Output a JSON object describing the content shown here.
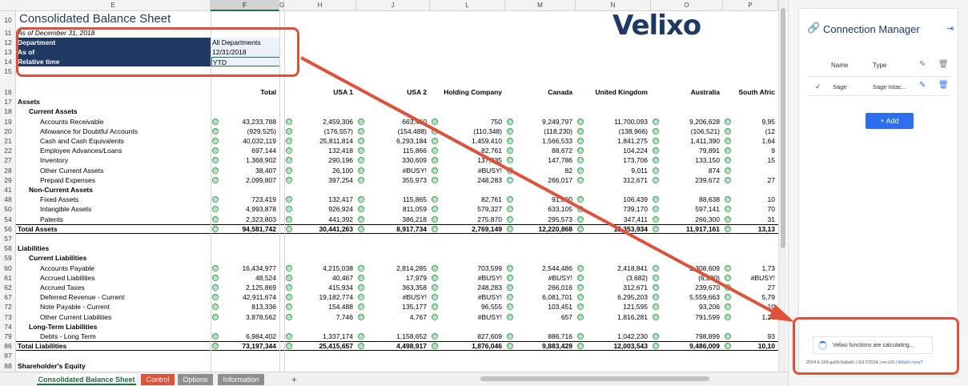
{
  "sheet": {
    "columns": [
      "E",
      "F",
      "G",
      "H",
      "J",
      "L",
      "M",
      "N",
      "O",
      "P"
    ],
    "selected_column": "F",
    "title": "Consolidated Balance Sheet",
    "subtitle": "As of December 31, 2018",
    "logo": "Velixo",
    "params": [
      {
        "label": "Department",
        "value": "All Departments"
      },
      {
        "label": "As of",
        "value": "12/31/2018"
      },
      {
        "label": "Relative time",
        "value": "YTD"
      }
    ],
    "top_rows": [
      "10",
      "11",
      "12",
      "13",
      "14",
      "15"
    ],
    "col_headers": [
      "Total",
      "USA 1",
      "USA 2",
      "Holding Company",
      "Canada",
      "United Kingdom",
      "Australia",
      "South Afric"
    ],
    "rows": [
      {
        "r": "16",
        "label": "",
        "kind": "hdr",
        "vals": []
      },
      {
        "r": "17",
        "label": "Assets",
        "kind": "bold",
        "vals": []
      },
      {
        "r": "18",
        "label": "Current Assets",
        "kind": "sub",
        "vals": []
      },
      {
        "r": "19",
        "label": "Accounts Receivable",
        "kind": "item",
        "vals": [
          "43,233,788",
          "2,459,306",
          "663,410",
          "750",
          "9,249,797",
          "11,700,093",
          "9,206,628",
          "9,95"
        ]
      },
      {
        "r": "20",
        "label": "Allowance for Doubtful Accounts",
        "kind": "item",
        "vals": [
          "(929,525)",
          "(176,557)",
          "(154,488)",
          "(110,348)",
          "(118,230)",
          "(138,966)",
          "(106,521)",
          "(12"
        ]
      },
      {
        "r": "21",
        "label": "Cash and Cash Equivalents",
        "kind": "item",
        "vals": [
          "40,032,119",
          "25,811,814",
          "6,293,184",
          "1,459,410",
          "1,566,533",
          "1,841,275",
          "1,411,390",
          "1,64"
        ]
      },
      {
        "r": "22",
        "label": "Employee Advances/Loans",
        "kind": "item",
        "vals": [
          "697,144",
          "132,418",
          "115,866",
          "82,761",
          "88,672",
          "104,224",
          "79,891",
          "9"
        ]
      },
      {
        "r": "27",
        "label": "Inventory",
        "kind": "item",
        "vals": [
          "1,368,902",
          "290,196",
          "330,609",
          "137,935",
          "147,786",
          "173,706",
          "133,150",
          "15"
        ]
      },
      {
        "r": "28",
        "label": "Other Current Assets",
        "kind": "item",
        "vals": [
          "38,407",
          "26,100",
          "#BUSY!",
          "#BUSY!",
          "82",
          "9,011",
          "874",
          ""
        ]
      },
      {
        "r": "29",
        "label": "Prepaid Expenses",
        "kind": "item",
        "vals": [
          "2,099,807",
          "397,254",
          "355,973",
          "248,283",
          "266,017",
          "312,671",
          "239,672",
          "27"
        ]
      },
      {
        "r": "41",
        "label": "Non-Current Assets",
        "kind": "sub",
        "vals": []
      },
      {
        "r": "48",
        "label": "Fixed Assets",
        "kind": "item",
        "vals": [
          "723,419",
          "132,417",
          "115,865",
          "82,761",
          "91,000",
          "106,439",
          "88,638",
          "10"
        ]
      },
      {
        "r": "50",
        "label": "Intangible Assets",
        "kind": "item",
        "vals": [
          "4,993,878",
          "926,924",
          "811,059",
          "579,327",
          "633,105",
          "739,170",
          "597,141",
          "70"
        ]
      },
      {
        "r": "54",
        "label": "Patents",
        "kind": "item",
        "vals": [
          "2,323,803",
          "441,392",
          "386,218",
          "275,870",
          "295,573",
          "347,411",
          "266,300",
          "31"
        ]
      },
      {
        "r": "56",
        "label": "Total Assets",
        "kind": "total",
        "vals": [
          "94,581,742",
          "30,441,263",
          "8,917,734",
          "2,769,149",
          "12,220,868",
          "15,353,934",
          "11,917,161",
          "13,13"
        ]
      },
      {
        "r": "57",
        "label": "",
        "kind": "blank",
        "vals": []
      },
      {
        "r": "58",
        "label": "Liabilities",
        "kind": "bold",
        "vals": []
      },
      {
        "r": "59",
        "label": "Current Liabilities",
        "kind": "sub",
        "vals": []
      },
      {
        "r": "60",
        "label": "Accounts Payable",
        "kind": "item",
        "vals": [
          "16,434,977",
          "4,215,038",
          "2,814,285",
          "703,599",
          "2,544,486",
          "2,418,841",
          "2,308,609",
          "1,73"
        ]
      },
      {
        "r": "61",
        "label": "Accrued Liabilities",
        "kind": "item",
        "vals": [
          "48,524",
          "40,467",
          "17,979",
          "#BUSY!",
          "#BUSY!",
          "(3,682)",
          "(6,290)",
          "#BUSY!"
        ]
      },
      {
        "r": "62",
        "label": "Accrued Taxes",
        "kind": "item",
        "vals": [
          "2,125,869",
          "415,934",
          "363,358",
          "248,283",
          "266,016",
          "312,671",
          "239,670",
          "27"
        ]
      },
      {
        "r": "67",
        "label": "Deferred Revenue - Current",
        "kind": "item",
        "vals": [
          "42,911,674",
          "19,182,774",
          "#BUSY!",
          "#BUSY!",
          "6,081,701",
          "6,295,203",
          "5,559,663",
          "5,79"
        ]
      },
      {
        "r": "72",
        "label": "Note Payable - Current",
        "kind": "item",
        "vals": [
          "813,336",
          "154,488",
          "135,177",
          "96,555",
          "103,451",
          "121,595",
          "93,206",
          "10"
        ]
      },
      {
        "r": "73",
        "label": "Other Current Liabilities",
        "kind": "item",
        "vals": [
          "3,878,562",
          "7,746",
          "4,767",
          "#BUSY!",
          "657",
          "1,816,281",
          "791,599",
          "1,25"
        ]
      },
      {
        "r": "74",
        "label": "Long-Term Liabilities",
        "kind": "sub",
        "vals": []
      },
      {
        "r": "79",
        "label": "Debts - Long Term",
        "kind": "item",
        "vals": [
          "6,984,402",
          "1,337,174",
          "1,158,652",
          "827,609",
          "886,716",
          "1,042,230",
          "798,899",
          "93"
        ]
      },
      {
        "r": "86",
        "label": "Total Liabilities",
        "kind": "total",
        "vals": [
          "73,197,344",
          "25,415,657",
          "4,498,917",
          "1,876,046",
          "9,883,429",
          "12,003,543",
          "9,486,009",
          "10,10"
        ]
      },
      {
        "r": "87",
        "label": "",
        "kind": "blank",
        "vals": []
      },
      {
        "r": "88",
        "label": "Shareholder's Equity",
        "kind": "bold",
        "vals": []
      }
    ]
  },
  "tabs": [
    {
      "label": "Consolidated Balance Sheet",
      "active": true
    },
    {
      "label": "Control",
      "color": "#e0513a"
    },
    {
      "label": "Options",
      "color": "#8e8e8e"
    },
    {
      "label": "Information",
      "color": "#8e8e8e"
    }
  ],
  "add_sheet": "+",
  "panel": {
    "title": "Connection Manager",
    "col_name": "Name",
    "col_type": "Type",
    "row_name": "Sage",
    "row_type": "Sage Intac...",
    "add_label": "Add",
    "status": "Velixo functions are calculating...",
    "version": "2024.4.159-ga5fc0a8a6c | 5/17/2024 | en-US |",
    "whats_new": "What's new?"
  },
  "colors": {
    "navy": "#1f3864",
    "accent": "#2b6ef0",
    "annotation": "#e0513a",
    "green": "#3aa655"
  }
}
